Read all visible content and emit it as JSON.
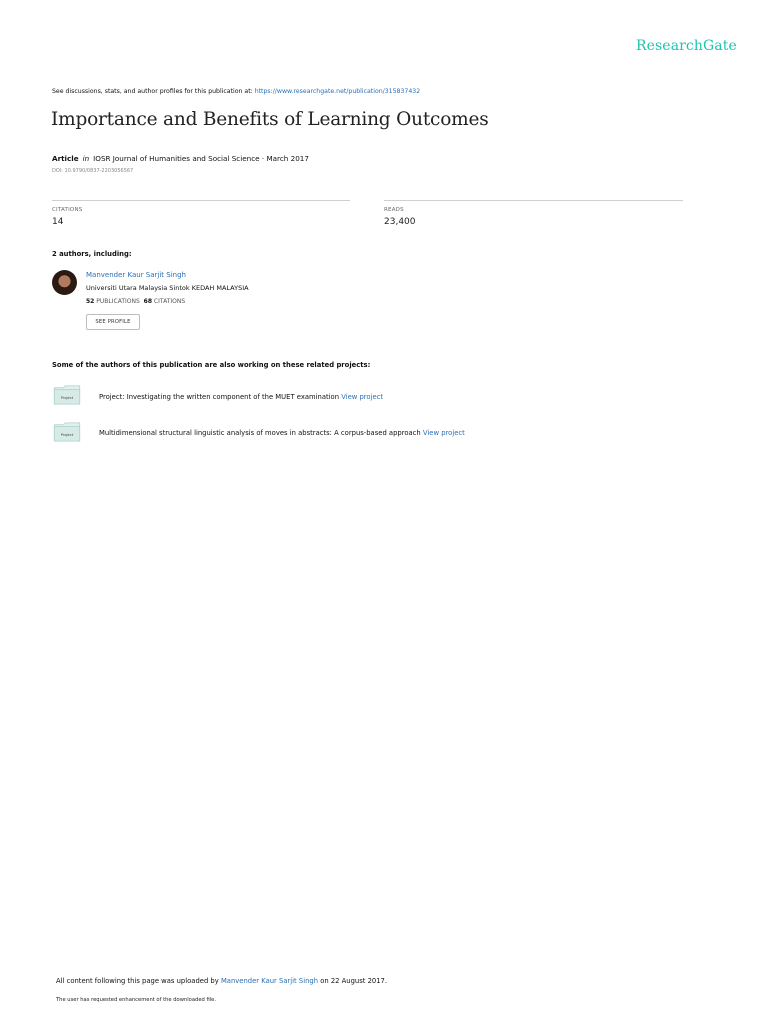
{
  "brand": {
    "logo_text": "ResearchGate",
    "accent": "#20c3b0",
    "link_color": "#2a6fb5"
  },
  "header": {
    "see_prefix": "See discussions, stats, and author profiles for this publication at:",
    "see_url": "https://www.researchgate.net/publication/315837432"
  },
  "publication": {
    "title": "Importance and Benefits of Learning Outcomes",
    "type": "Article",
    "in_word": "in",
    "venue": "IOSR Journal of Humanities and Social Science · March 2017",
    "doi": "DOI: 10.9790/0837-2203056567"
  },
  "stats": [
    {
      "label": "CITATIONS",
      "value": "14"
    },
    {
      "label": "READS",
      "value": "23,400"
    }
  ],
  "authors": {
    "heading": "2 authors, including:",
    "list": [
      {
        "name": "Manvender Kaur Sarjit Singh",
        "affiliation": "Universiti Utara Malaysia Sintok KEDAH MALAYSIA",
        "publications_count": "52",
        "publications_label": "PUBLICATIONS",
        "citations_count": "68",
        "citations_label": "CITATIONS",
        "button_label": "SEE PROFILE"
      }
    ]
  },
  "projects": {
    "heading": "Some of the authors of this publication are also working on these related projects:",
    "items": [
      {
        "icon_label": "Project",
        "text": "Project: Investigating the written component of the MUET examination",
        "link": "View project"
      },
      {
        "icon_label": "Project",
        "text": "Multidimensional structural linguistic analysis of moves in abstracts: A corpus-based approach",
        "link": "View project"
      }
    ]
  },
  "footer": {
    "line1_prefix": "All content following this page was uploaded by",
    "uploader": "Manvender Kaur Sarjit Singh",
    "line1_suffix": "on 22 August 2017.",
    "line2": "The user has requested enhancement of the downloaded file."
  }
}
